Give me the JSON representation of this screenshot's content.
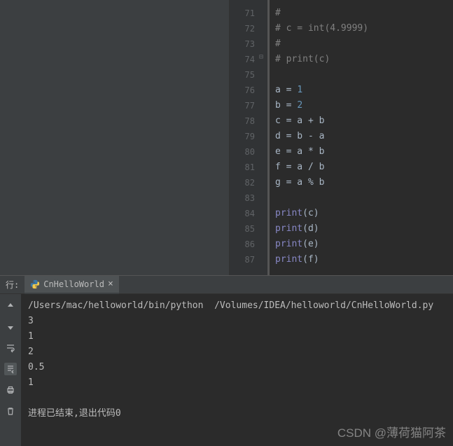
{
  "gutter": {
    "lines": [
      "71",
      "72",
      "73",
      "74",
      "75",
      "76",
      "77",
      "78",
      "79",
      "80",
      "81",
      "82",
      "83",
      "84",
      "85",
      "86",
      "87"
    ]
  },
  "code": {
    "l71_c": "# ",
    "l72_c": "# c = int(4.9999)",
    "l73_c": "# ",
    "l74_c": "# print(c)",
    "l75": "",
    "l76_v": "a",
    "l76_eq": " = ",
    "l76_n": "1",
    "l77_v": "b",
    "l77_eq": " = ",
    "l77_n": "2",
    "l78": "c = a + b",
    "l79": "d = b - a",
    "l80": "e = a * b",
    "l81": "f = a / b",
    "l82": "g = a % b",
    "l83": "",
    "l84_fn": "print",
    "l84_arg": "(c)",
    "l85_fn": "print",
    "l85_arg": "(d)",
    "l86_fn": "print",
    "l86_arg": "(e)",
    "l87_fn": "print",
    "l87_arg": "(f)"
  },
  "run": {
    "panel_label": "行:",
    "tab_label": "CnHelloWorld",
    "cmd": "/Users/mac/helloworld/bin/python  /Volumes/IDEA/helloworld/CnHelloWorld.py",
    "out": [
      "3",
      "1",
      "2",
      "0.5",
      "1"
    ],
    "exit": "进程已结束,退出代码0"
  },
  "watermark": "CSDN @薄荷猫阿茶"
}
